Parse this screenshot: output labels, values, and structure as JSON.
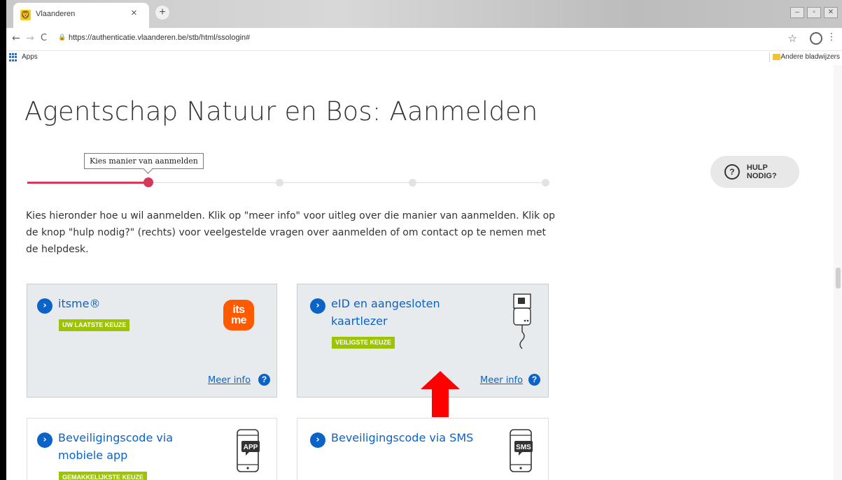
{
  "browser": {
    "tab_title": "Vlaanderen",
    "tab_close": "×",
    "new_tab": "+",
    "url": "https://authenticatie.vlaanderen.be/stb/html/ssologin#",
    "apps_label": "Apps",
    "other_bookmarks_label": "Andere bladwijzers",
    "icons": [
      "back-icon",
      "forward-icon",
      "reload-icon",
      "lock-icon",
      "star-icon",
      "profile-icon",
      "menu-icon",
      "apps-icon",
      "folder-icon"
    ]
  },
  "page": {
    "title": "Agentschap Natuur en Bos: Aanmelden",
    "step_label": "Kies manier van aanmelden",
    "step_progress": {
      "current_step": 1,
      "total_steps": 5
    },
    "help_button": {
      "icon_text": "?",
      "label": "HULP NODIG?"
    },
    "intro": "Kies hieronder hoe u wil aanmelden. Klik op \"meer info\" voor uitleg over die manier van aanmelden. Klik op de knop \"hulp nodig?\" (rechts) voor veelgestelde vragen over aanmelden of om contact op te nemen met de helpdesk.",
    "options": [
      {
        "title": "itsme®",
        "badge": "UW LAATSTE KEUZE",
        "more_info": "Meer info",
        "icon": "itsme-logo",
        "logo_text_top": "its",
        "logo_text_bottom": "me"
      },
      {
        "title_line1": "eID en aangesloten",
        "title_line2": "kaartlezer",
        "badge": "VEILIGSTE KEUZE",
        "more_info": "Meer info",
        "icon": "card-reader-icon"
      },
      {
        "title_line1": "Beveiligingscode via",
        "title_line2": "mobiele app",
        "badge": "GEMAKKELIJKSTE KEUZE",
        "icon": "phone-app-icon",
        "icon_text": "APP"
      },
      {
        "title": "Beveiligingscode via SMS",
        "icon": "phone-sms-icon",
        "icon_text": "SMS"
      }
    ],
    "info_icon_text": "?",
    "chevron": "›"
  },
  "annotation": {
    "arrow_color": "#ff0000",
    "icon": "red-up-arrow"
  },
  "colors": {
    "primary_blue": "#0a63c9",
    "badge_green": "#9cc400",
    "progress_red": "#d6385a",
    "card_bg": "#e8ebee",
    "itsme_orange": "#ff5a00"
  }
}
